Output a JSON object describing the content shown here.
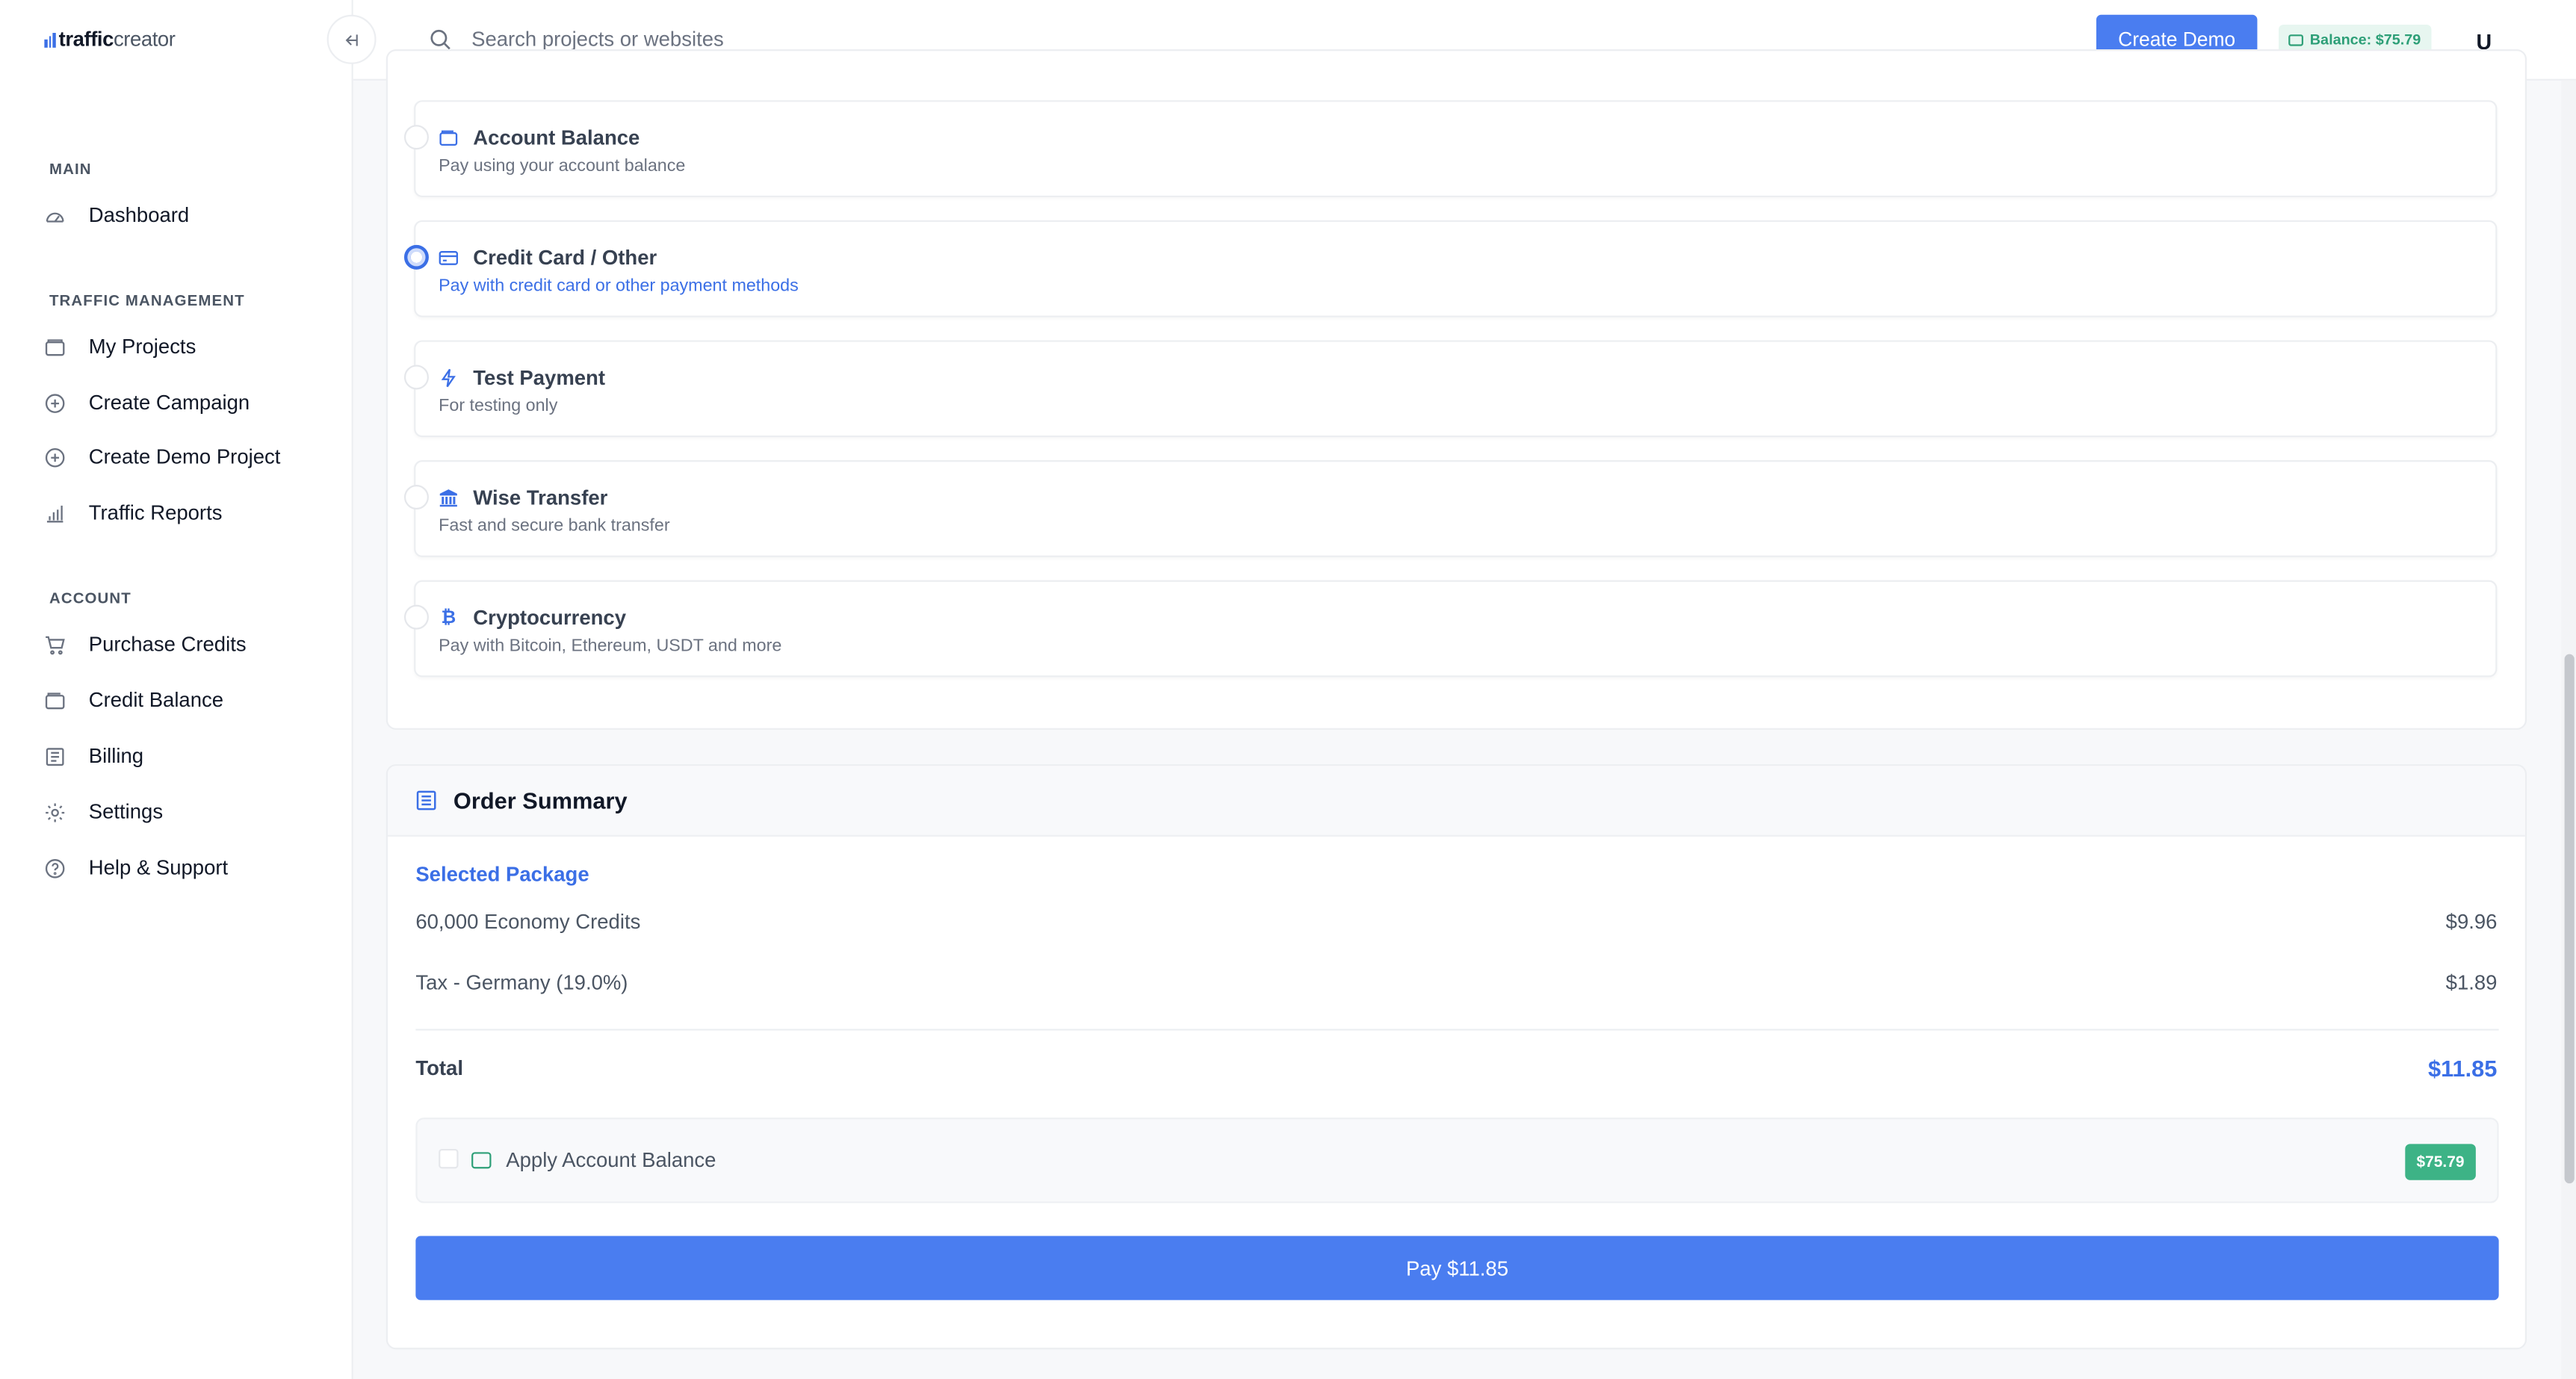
{
  "brand": {
    "part1": "traffic",
    "part2": "creator"
  },
  "sidebar": {
    "sections": [
      {
        "label": "MAIN"
      },
      {
        "label": "TRAFFIC MANAGEMENT"
      },
      {
        "label": "ACCOUNT"
      }
    ],
    "items": [
      {
        "label": "Dashboard",
        "icon": "gauge-icon"
      },
      {
        "label": "My Projects",
        "icon": "folder-icon"
      },
      {
        "label": "Create Campaign",
        "icon": "plus-circle-icon"
      },
      {
        "label": "Create Demo Project",
        "icon": "plus-circle-icon"
      },
      {
        "label": "Traffic Reports",
        "icon": "bar-chart-icon"
      },
      {
        "label": "Purchase Credits",
        "icon": "cart-icon"
      },
      {
        "label": "Credit Balance",
        "icon": "wallet-icon"
      },
      {
        "label": "Billing",
        "icon": "receipt-icon"
      },
      {
        "label": "Settings",
        "icon": "gear-icon"
      },
      {
        "label": "Help & Support",
        "icon": "help-circle-icon"
      }
    ]
  },
  "topbar": {
    "search_placeholder": "Search projects or websites",
    "create_demo_label": "Create Demo",
    "balance_label": "Balance: $75.79",
    "avatar_initial": "U"
  },
  "payment_methods": [
    {
      "title": "Account Balance",
      "desc": "Pay using your account balance",
      "icon": "wallet-icon",
      "selected": false
    },
    {
      "title": "Credit Card / Other",
      "desc": "Pay with credit card or other payment methods",
      "icon": "credit-card-icon",
      "selected": true
    },
    {
      "title": "Test Payment",
      "desc": "For testing only",
      "icon": "bolt-icon",
      "selected": false
    },
    {
      "title": "Wise Transfer",
      "desc": "Fast and secure bank transfer",
      "icon": "bank-icon",
      "selected": false
    },
    {
      "title": "Cryptocurrency",
      "desc": "Pay with Bitcoin, Ethereum, USDT and more",
      "icon": "bitcoin-icon",
      "selected": false
    }
  ],
  "order_summary": {
    "title": "Order Summary",
    "selected_package_label": "Selected Package",
    "lines": [
      {
        "label": "60,000 Economy Credits",
        "value": "$9.96"
      },
      {
        "label": "Tax - Germany (19.0%)",
        "value": "$1.89"
      }
    ],
    "total_label": "Total",
    "total_value": "$11.85",
    "apply_balance_label": "Apply Account Balance",
    "apply_balance_amount": "$75.79",
    "pay_button_label": "Pay $11.85"
  },
  "colors": {
    "primary": "#4a7df0",
    "accent_green": "#3db386"
  }
}
